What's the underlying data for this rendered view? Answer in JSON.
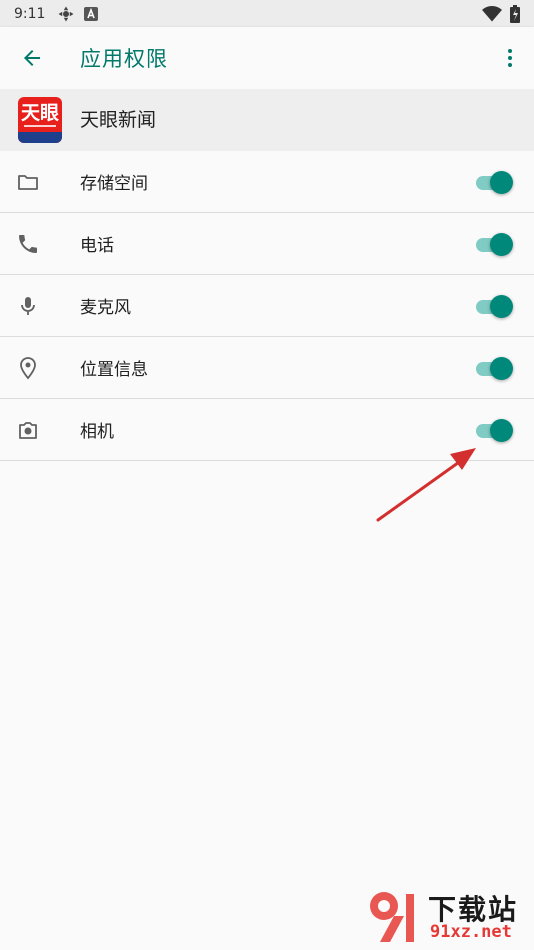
{
  "status_bar": {
    "time": "9:11"
  },
  "app_bar": {
    "title": "应用权限"
  },
  "app": {
    "name": "天眼新闻",
    "logo_text": "天眼"
  },
  "permissions": [
    {
      "label": "存储空间",
      "icon": "folder-icon",
      "enabled": true
    },
    {
      "label": "电话",
      "icon": "phone-icon",
      "enabled": true
    },
    {
      "label": "麦克风",
      "icon": "microphone-icon",
      "enabled": true
    },
    {
      "label": "位置信息",
      "icon": "location-pin-icon",
      "enabled": true
    },
    {
      "label": "相机",
      "icon": "camera-icon",
      "enabled": true
    }
  ],
  "colors": {
    "accent": "#00796b",
    "switch_thumb": "#00897b",
    "switch_track": "#80cbc4",
    "annotation_arrow": "#d32f2f"
  },
  "watermark": {
    "title": "下载站",
    "url": "91xz.net"
  }
}
